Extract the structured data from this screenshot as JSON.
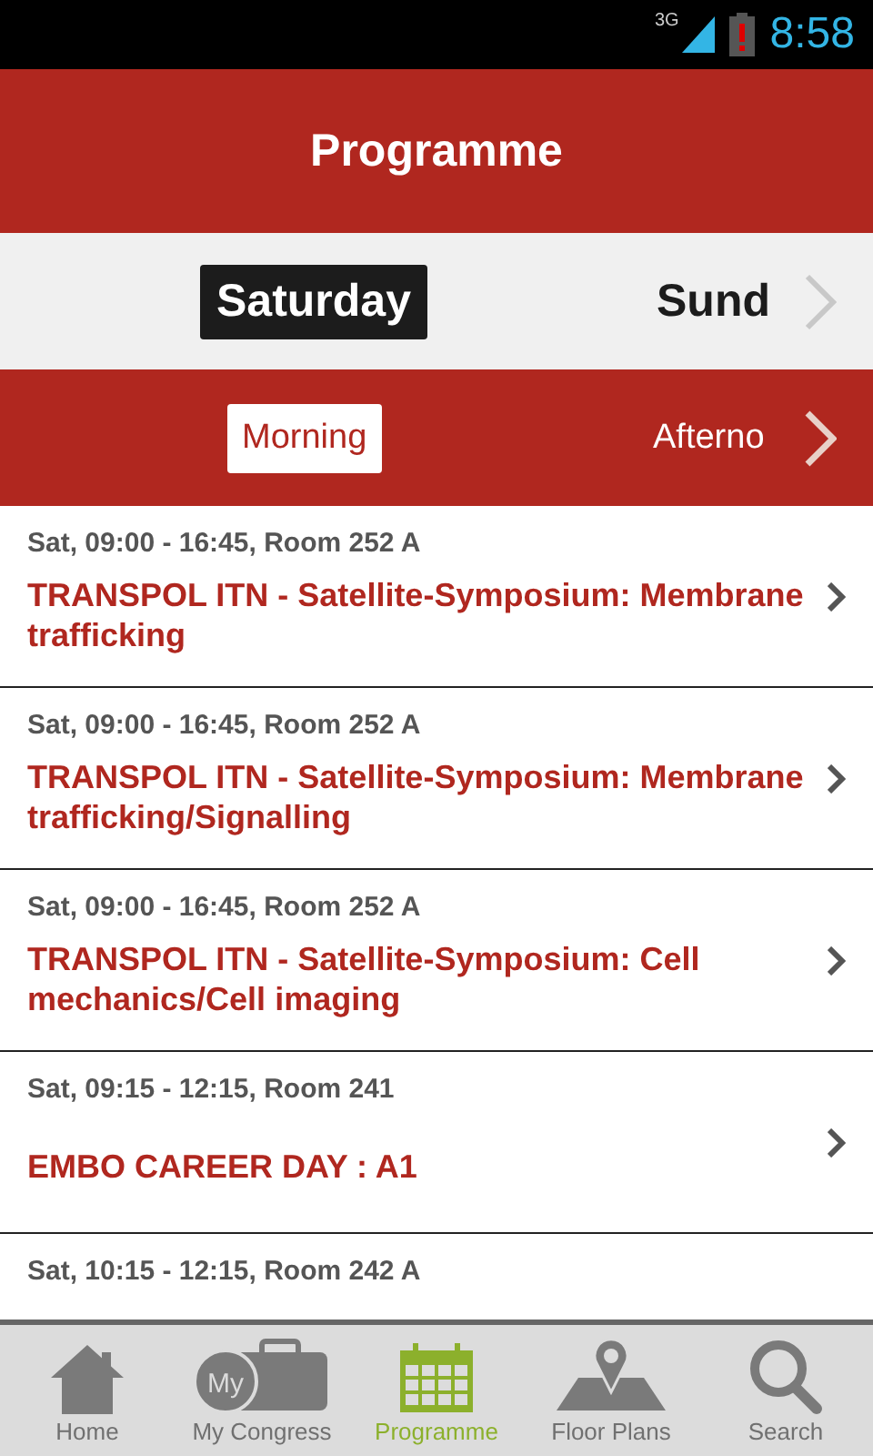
{
  "status_bar": {
    "network": "3G",
    "time": "8:58"
  },
  "header": {
    "title": "Programme"
  },
  "days": [
    {
      "label": "Saturday",
      "selected": true
    },
    {
      "label": "Sund",
      "selected": false
    }
  ],
  "periods": [
    {
      "label": "Morning",
      "selected": true
    },
    {
      "label": "Afterno",
      "selected": false
    }
  ],
  "sessions": [
    {
      "meta": "Sat, 09:00 - 16:45, Room 252 A",
      "title": "TRANSPOL ITN - Satellite-Symposium: Membrane trafficking"
    },
    {
      "meta": "Sat, 09:00 - 16:45, Room 252 A",
      "title": "TRANSPOL ITN - Satellite-Symposium: Membrane trafficking/Signalling"
    },
    {
      "meta": "Sat, 09:00 - 16:45, Room 252 A",
      "title": "TRANSPOL ITN - Satellite-Symposium: Cell mechanics/Cell imaging"
    },
    {
      "meta": "Sat, 09:15 - 12:15, Room 241",
      "title": "EMBO CAREER DAY : A1"
    },
    {
      "meta": "Sat, 10:15 - 12:15, Room 242 A"
    }
  ],
  "tab_bar": [
    {
      "kind": "home",
      "label": "Home",
      "selected": false
    },
    {
      "kind": "briefcase",
      "label": "My Congress",
      "badge": "My",
      "selected": false
    },
    {
      "kind": "calendar",
      "label": "Programme",
      "selected": true
    },
    {
      "kind": "map",
      "label": "Floor Plans",
      "selected": false
    },
    {
      "kind": "search",
      "label": "Search",
      "selected": false
    }
  ]
}
